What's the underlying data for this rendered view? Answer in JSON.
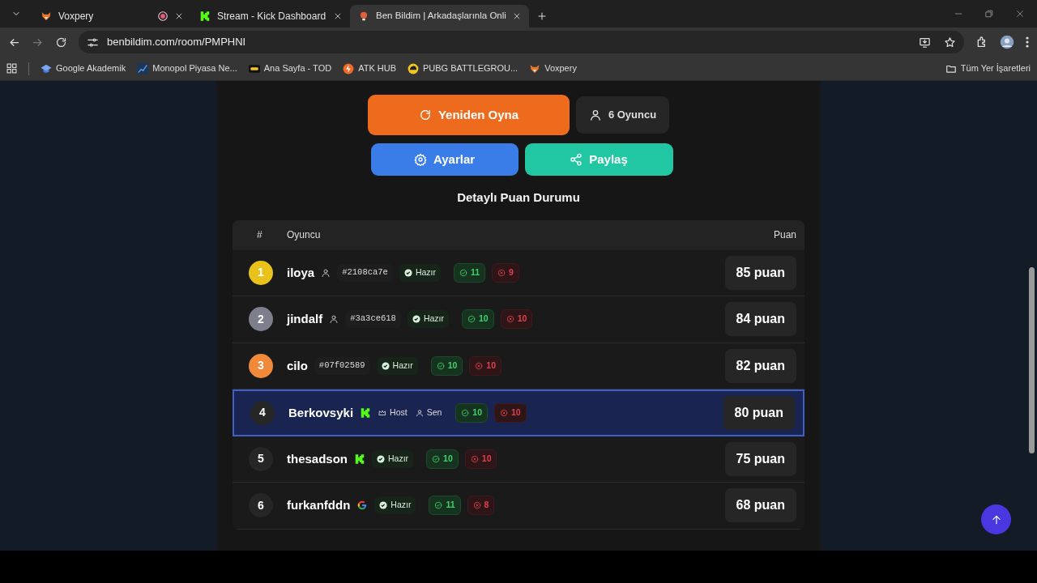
{
  "browser": {
    "tabs": [
      {
        "title": "Voxpery",
        "recording": true,
        "selected": false
      },
      {
        "title": "Stream - Kick Dashboard",
        "recording": false,
        "selected": false
      },
      {
        "title": "Ben Bildim | Arkadaşlarınla Onli",
        "recording": false,
        "selected": true
      }
    ],
    "url": "benbildim.com/room/PMPHNI",
    "bookmarks": [
      "Google Akademik",
      "Monopol Piyasa Ne...",
      "Ana Sayfa - TOD",
      "ATK HUB",
      "PUBG BATTLEGROU...",
      "Voxpery"
    ],
    "all_bookmarks": "Tüm Yer İşaretleri"
  },
  "actions": {
    "replay": "Yeniden Oyna",
    "player_count": "6 Oyuncu",
    "settings": "Ayarlar",
    "share": "Paylaş"
  },
  "section_title": "Detaylı Puan Durumu",
  "table": {
    "columns": [
      "#",
      "Oyuncu",
      "Puan"
    ],
    "rows": [
      {
        "rank": "1",
        "color": "#e8c21a",
        "name": "iloya",
        "kind": "user",
        "tags": [
          {
            "kind": "id",
            "text": "#2108ca7e"
          },
          {
            "kind": "ready",
            "text": "Hazır"
          }
        ],
        "correct": "11",
        "wrong": "9",
        "score": "85 puan",
        "selected": false
      },
      {
        "rank": "2",
        "color": "#7d808c",
        "name": "jindalf",
        "kind": "user",
        "tags": [
          {
            "kind": "id",
            "text": "#3a3ce618"
          },
          {
            "kind": "ready",
            "text": "Hazır"
          }
        ],
        "correct": "10",
        "wrong": "10",
        "score": "84 puan",
        "selected": false
      },
      {
        "rank": "3",
        "color": "#f08a3a",
        "name": "cilo",
        "kind": "plain",
        "tags": [
          {
            "kind": "id",
            "text": "#07f02589"
          },
          {
            "kind": "ready",
            "text": "Hazır"
          }
        ],
        "correct": "10",
        "wrong": "10",
        "score": "82 puan",
        "selected": false
      },
      {
        "rank": "4",
        "color": "#262626",
        "name": "Berkovsyki",
        "kind": "kick",
        "tags": [
          {
            "kind": "host",
            "text": "Host"
          },
          {
            "kind": "you",
            "text": "Sen"
          }
        ],
        "correct": "10",
        "wrong": "10",
        "score": "80 puan",
        "selected": true
      },
      {
        "rank": "5",
        "color": "#262626",
        "name": "thesadson",
        "kind": "kick",
        "tags": [
          {
            "kind": "ready",
            "text": "Hazır"
          }
        ],
        "correct": "10",
        "wrong": "10",
        "score": "75 puan",
        "selected": false
      },
      {
        "rank": "6",
        "color": "#262626",
        "name": "furkanfddn",
        "kind": "google",
        "tags": [
          {
            "kind": "ready",
            "text": "Hazır"
          }
        ],
        "correct": "11",
        "wrong": "8",
        "score": "68 puan",
        "selected": false
      }
    ]
  }
}
